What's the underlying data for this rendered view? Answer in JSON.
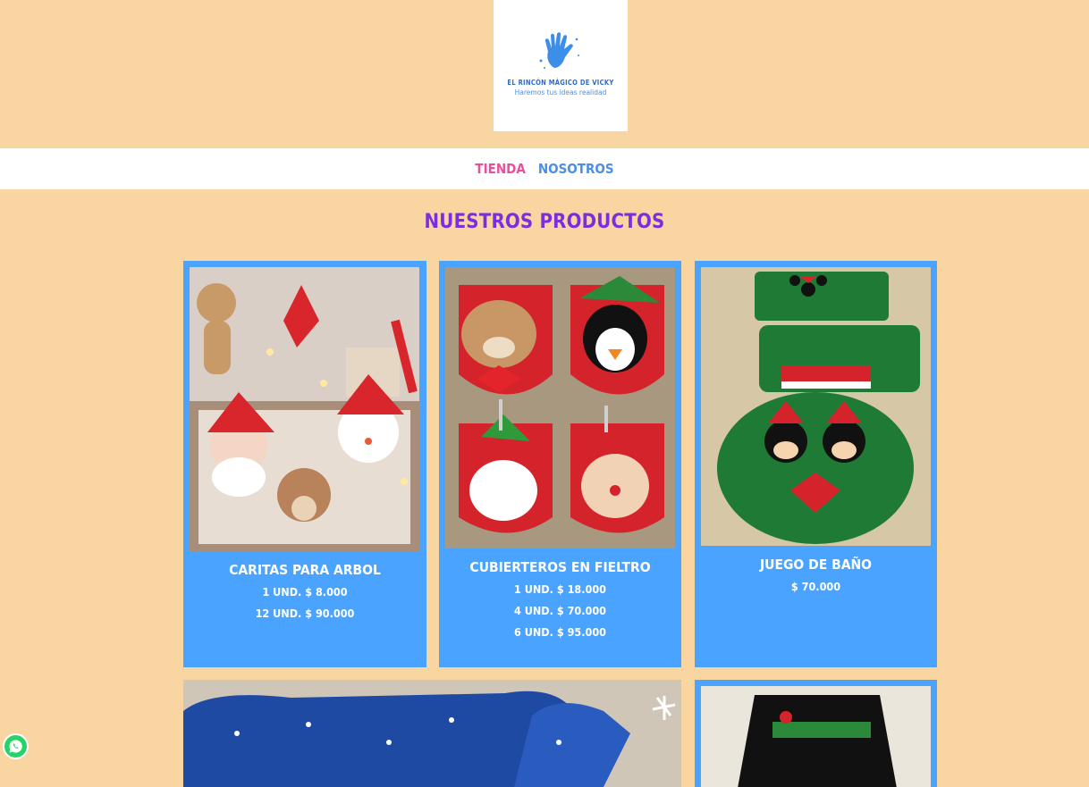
{
  "brand": {
    "name": "EL RINCÓN MÁGICO DE VICKY",
    "tagline": "Haremos tus ideas realidad",
    "logo_icon": "hand-icon",
    "accent_color": "#4aa3ff"
  },
  "nav": {
    "items": [
      {
        "label": "TIENDA",
        "color": "#ec4e9d"
      },
      {
        "label": "NOSOTROS",
        "color": "#4a90e2"
      }
    ]
  },
  "main": {
    "title": "NUESTROS PRODUCTOS"
  },
  "products": [
    {
      "name": "CARITAS PARA ARBOL",
      "prices": [
        "1 UND. $ 8.000",
        "12 UND. $ 90.000"
      ],
      "image": "felt christmas ornaments"
    },
    {
      "name": "CUBIERTEROS EN FIELTRO",
      "prices": [
        "1 UND. $ 18.000",
        "4 UND. $ 70.000",
        "6 UND. $ 95.000"
      ],
      "image": "felt cutlery holders"
    },
    {
      "name": "JUEGO DE BAÑO",
      "prices": [
        "$ 70.000"
      ],
      "image": "christmas bathroom set"
    },
    {
      "name": "",
      "prices": [],
      "image": "blue snowflake cushions"
    },
    {
      "name": "",
      "prices": [],
      "image": "snowman cushion"
    }
  ],
  "floating": {
    "whatsapp_icon": "whatsapp-icon"
  }
}
